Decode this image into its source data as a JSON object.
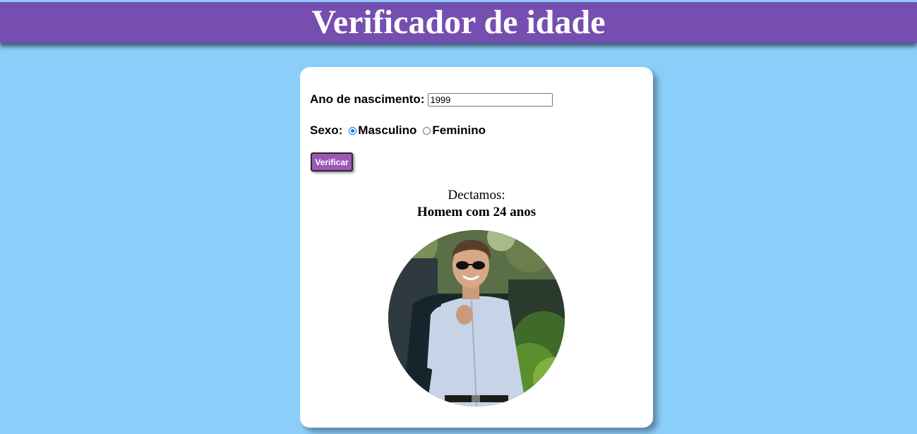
{
  "header": {
    "title": "Verificador de idade"
  },
  "form": {
    "year_label": "Ano de nascimento:",
    "year_value": "1999",
    "sex_label": "Sexo:",
    "options": [
      {
        "label": "Masculino",
        "checked": true
      },
      {
        "label": "Feminino",
        "checked": false
      }
    ],
    "submit_label": "Verificar"
  },
  "result": {
    "intro": "Dectamos:",
    "message": "Homem com 24 anos",
    "image_icon": "man-portrait-photo"
  },
  "colors": {
    "background": "#8ccefa",
    "header": "#754eb0",
    "button": "#9b59b6",
    "card": "#ffffff"
  }
}
